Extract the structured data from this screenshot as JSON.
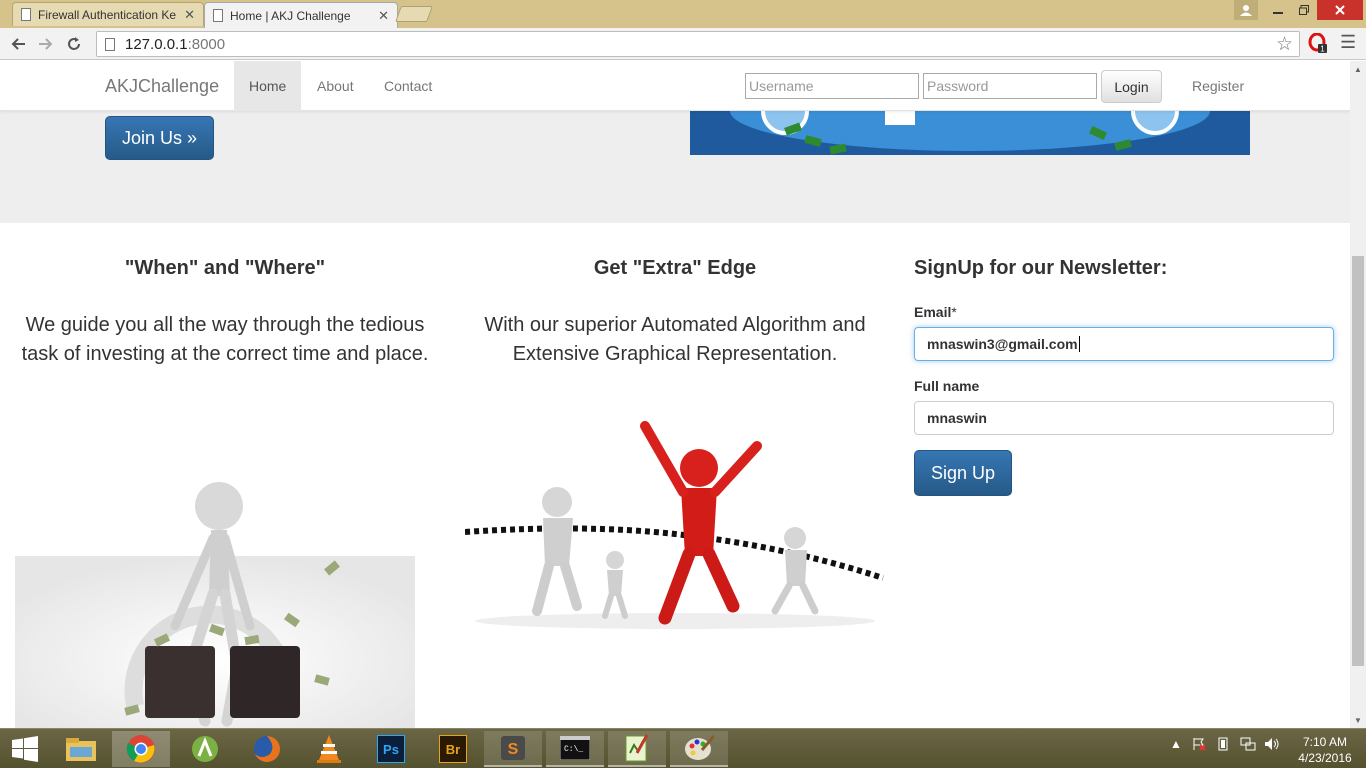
{
  "browser": {
    "tabs": [
      {
        "label": "Firewall Authentication Ke",
        "active": false
      },
      {
        "label": "Home | AKJ Challenge",
        "active": true
      }
    ],
    "url_host": "127.0.0.1",
    "url_port": ":8000"
  },
  "navbar": {
    "brand": "AKJChallenge",
    "links": [
      "Home",
      "About",
      "Contact"
    ],
    "username_placeholder": "Username",
    "password_placeholder": "Password",
    "login_label": "Login",
    "register_label": "Register"
  },
  "jumbotron": {
    "join_label": "Join Us »"
  },
  "columns": [
    {
      "title": "\"When\" and \"Where\"",
      "text": "We guide you all the way through the tedious task of investing at the correct time and place."
    },
    {
      "title": "Get \"Extra\" Edge",
      "text": "With our superior Automated Algorithm and Extensive Graphical Representation."
    }
  ],
  "newsletter": {
    "title": "SignUp for our Newsletter:",
    "email_label": "Email",
    "email_required": "*",
    "email_value": "mnaswin3@gmail.com",
    "name_label": "Full name",
    "name_value": "mnaswin",
    "signup_label": "Sign Up"
  },
  "taskbar": {
    "apps": [
      "windows-start",
      "file-explorer",
      "chrome",
      "android-studio",
      "firefox",
      "vlc",
      "photoshop",
      "bridge",
      "sublime-text",
      "command-prompt",
      "notepad-plus",
      "paint"
    ],
    "time": "7:10 AM",
    "date": "4/23/2016"
  },
  "colors": {
    "primary": "#337ab7",
    "titlebar": "#d5c38b",
    "taskbar": "#5f5b3a",
    "jumbotron": "#eeeeee",
    "figure_red": "#d8201c"
  }
}
